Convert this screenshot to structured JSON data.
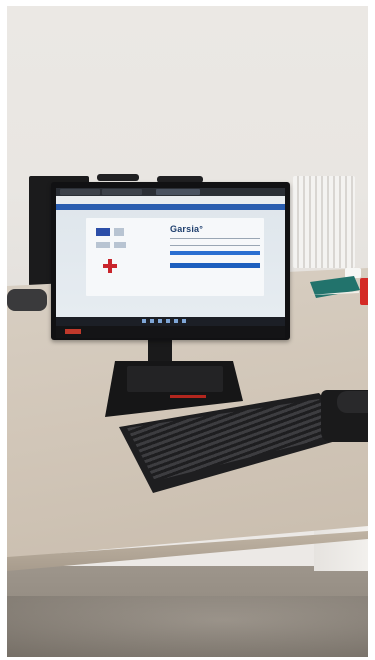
{
  "scene": {
    "description_colors": {
      "wall": "#ebe8e4",
      "desk": "#d2c7b9",
      "monitor_frame": "#111113",
      "screen_header": "#2a5db0",
      "login_button": "#2a6fd1"
    },
    "screen": {
      "app_title": "Garsia°"
    }
  }
}
